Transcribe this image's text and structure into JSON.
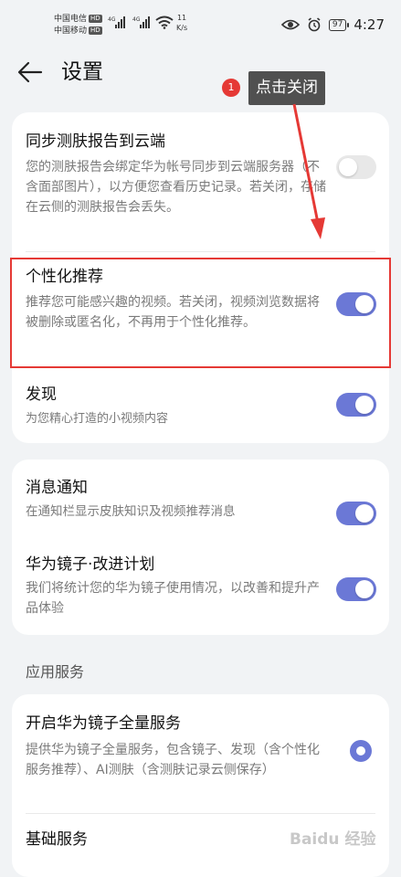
{
  "status_bar": {
    "carrier_1": "中国电信",
    "carrier_2": "中国移动",
    "hd_badge": "HD",
    "signal_1_label": "4G",
    "signal_2_label": "4G",
    "net_speed_value": "11",
    "net_speed_unit": "K/s",
    "battery": "97",
    "time": "4:27"
  },
  "header": {
    "title": "设置"
  },
  "annotation": {
    "step": "1",
    "text": "点击关闭"
  },
  "card1": {
    "items": [
      {
        "title": "同步测肤报告到云端",
        "desc": "您的测肤报告会绑定华为帐号同步到云端服务器（不含面部图片），以方便您查看历史记录。若关闭，存储在云侧的测肤报告会丢失。",
        "toggle_on": false
      },
      {
        "title": "个性化推荐",
        "desc": "推荐您可能感兴趣的视频。若关闭，视频浏览数据将被删除或匿名化，不再用于个性化推荐。",
        "toggle_on": true
      },
      {
        "title": "发现",
        "desc": "为您精心打造的小视频内容",
        "toggle_on": true
      }
    ]
  },
  "card2": {
    "items": [
      {
        "title": "消息通知",
        "desc": "在通知栏显示皮肤知识及视频推荐消息",
        "toggle_on": true
      },
      {
        "title": "华为镜子·改进计划",
        "desc": "我们将统计您的华为镜子使用情况，以改善和提升产品体验",
        "toggle_on": true
      }
    ]
  },
  "section_app_services": "应用服务",
  "card3": {
    "items": [
      {
        "title": "开启华为镜子全量服务",
        "desc": "提供华为镜子全量服务，包含镜子、发现（含个性化服务推荐）、AI测肤（含测肤记录云侧保存）",
        "selected": true
      },
      {
        "title": "基础服务"
      }
    ]
  },
  "watermark": "Baidu 经验",
  "colors": {
    "accent": "#6b78d6",
    "annotation_red": "#e53935"
  }
}
